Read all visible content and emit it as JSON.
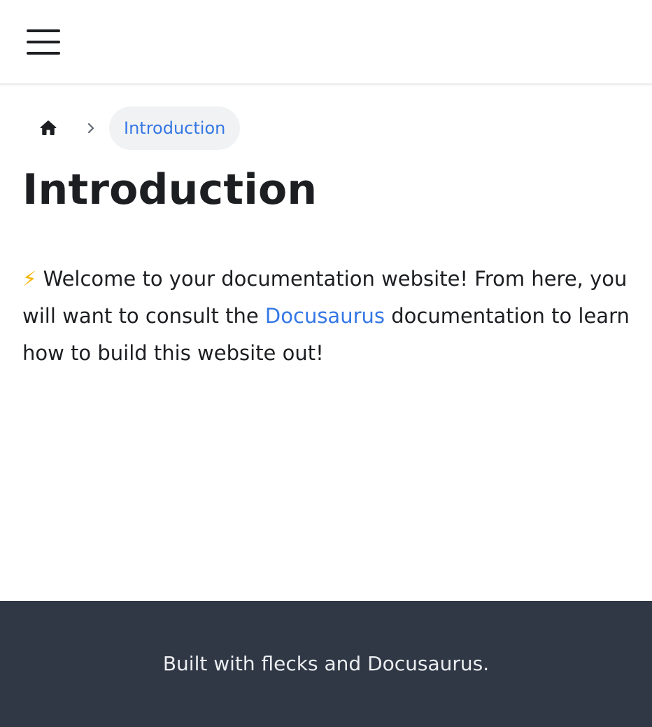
{
  "navbar": {
    "menu_icon": "hamburger-menu-icon"
  },
  "breadcrumbs": {
    "home_icon": "home-icon",
    "separator_icon": "chevron-right-icon",
    "current": "Introduction"
  },
  "page": {
    "title": "Introduction",
    "paragraph": {
      "emoji": "⚡",
      "text_before": " Welcome to your documentation website! From here, you will want to consult the ",
      "link_text": "Docusaurus",
      "text_after": " documentation to learn how to build this website out!"
    }
  },
  "footer": {
    "copyright": "Built with flecks and Docusaurus."
  },
  "colors": {
    "link": "#3578e5",
    "footer_bg": "#303846",
    "text": "#1c1e21"
  }
}
